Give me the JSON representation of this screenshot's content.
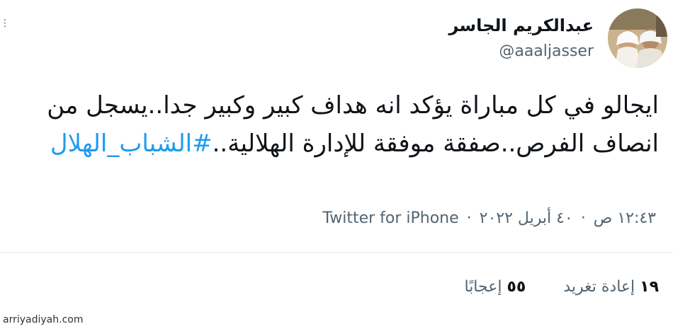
{
  "author": {
    "name": "عبدالكريم الجاسر",
    "handle": "@aaaljasser"
  },
  "tweet": {
    "text": "ايجالو في كل مباراة يؤكد انه هداف كبير وكبير جدا..يسجل من انصاف الفرص..صفقة موفقة للإدارة الهلالية..",
    "hashtag": "#الشباب_الهلال"
  },
  "meta": {
    "time": "١٢:٤٣ ص",
    "date": "٤٠ أبريل ٢٠٢٢",
    "separator": "·",
    "source": "Twitter for iPhone"
  },
  "stats": {
    "retweets_count": "١٩",
    "retweets_label": "إعادة تغريد",
    "likes_count": "٥٥",
    "likes_label": "إعجابًا"
  },
  "watermark": "arriyadiyah.com",
  "icons": {
    "more": "more-options-icon"
  },
  "colors": {
    "link": "#1d9bf0",
    "secondary_text": "#536471",
    "primary_text": "#0f1419"
  }
}
